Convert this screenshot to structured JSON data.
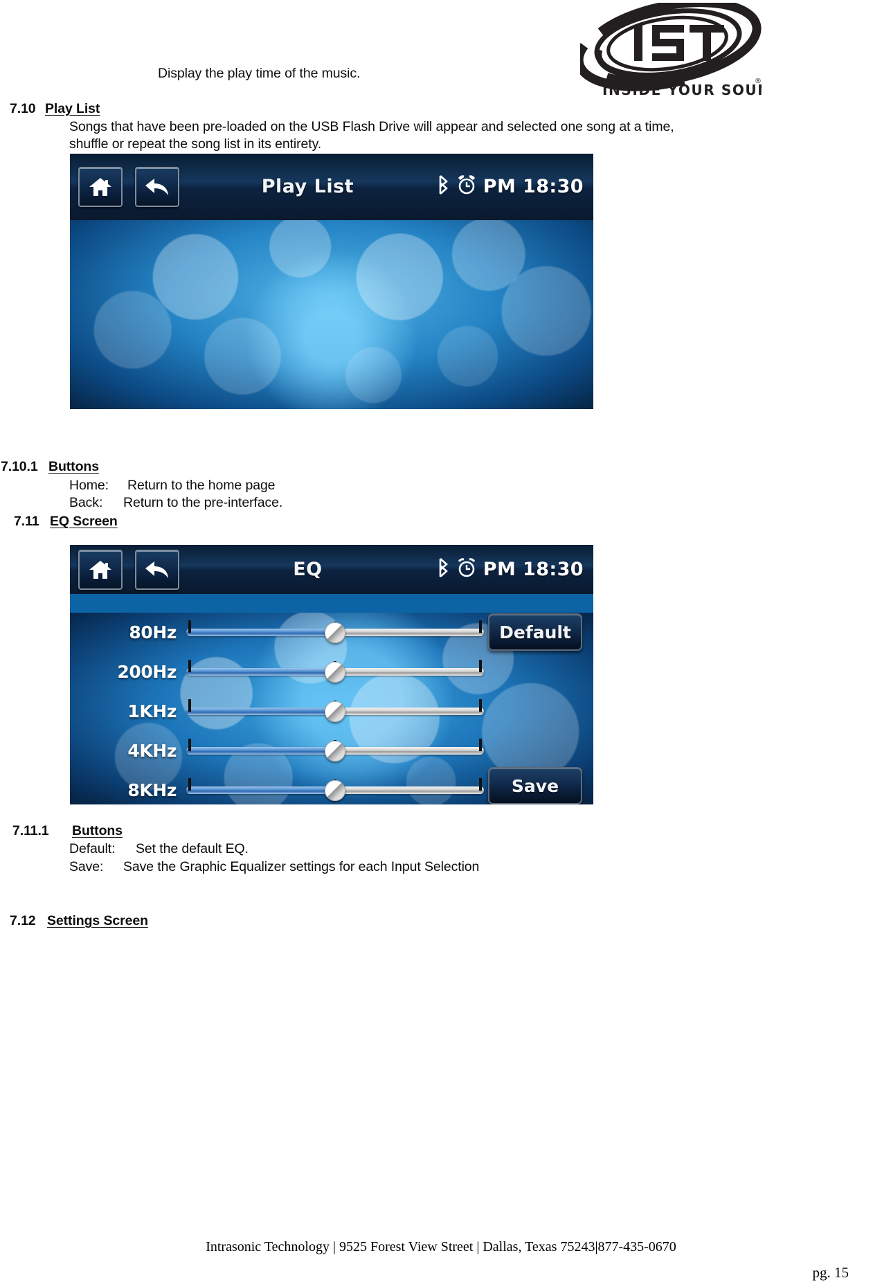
{
  "logo": {
    "mark_text": "IST",
    "tagline": "INSIDE YOUR SOUND",
    "registered_mark": "®"
  },
  "body": {
    "intro_line": "Display the play time of the music.",
    "section_7_10": {
      "number": "7.10",
      "title": "Play List",
      "paragraph_line1": "Songs that have been pre-loaded on the USB Flash Drive will appear and selected one song at a time,",
      "paragraph_line2": "shuffle or repeat the song list in its entirety."
    },
    "section_7_10_1": {
      "number": "7.10.1",
      "title": "Buttons",
      "rows": [
        {
          "label": "Home:",
          "desc": "Return to the home page"
        },
        {
          "label": "Back:",
          "desc": "Return to the pre-interface."
        }
      ]
    },
    "section_7_11": {
      "number": "7.11",
      "title": "EQ Screen"
    },
    "section_7_11_1": {
      "number": "7.11.1",
      "title": "Buttons",
      "rows": [
        {
          "label": "Default:",
          "desc": "Set the default EQ."
        },
        {
          "label": "Save:",
          "desc": "Save the Graphic Equalizer settings for each Input Selection"
        }
      ]
    },
    "section_7_12": {
      "number": "7.12",
      "title": "Settings Screen"
    }
  },
  "playlist_screen": {
    "title": "Play List",
    "clock": "PM 18:30",
    "home_icon": "home-icon",
    "back_icon": "back-arrow-icon",
    "bluetooth_icon": "bluetooth-icon",
    "alarm_icon": "alarm-clock-icon"
  },
  "eq_screen": {
    "title": "EQ",
    "clock": "PM 18:30",
    "home_icon": "home-icon",
    "back_icon": "back-arrow-icon",
    "bluetooth_icon": "bluetooth-icon",
    "alarm_icon": "alarm-clock-icon",
    "bands": [
      {
        "label": "80Hz",
        "value": 50
      },
      {
        "label": "200Hz",
        "value": 50
      },
      {
        "label": "1KHz",
        "value": 50
      },
      {
        "label": "4KHz",
        "value": 50
      },
      {
        "label": "8KHz",
        "value": 50
      }
    ],
    "default_button": "Default",
    "save_button": "Save"
  },
  "footer": {
    "company_line": "Intrasonic Technology | 9525 Forest View Street | Dallas, Texas 75243|877-435-0670",
    "page_label": "pg. 15"
  }
}
